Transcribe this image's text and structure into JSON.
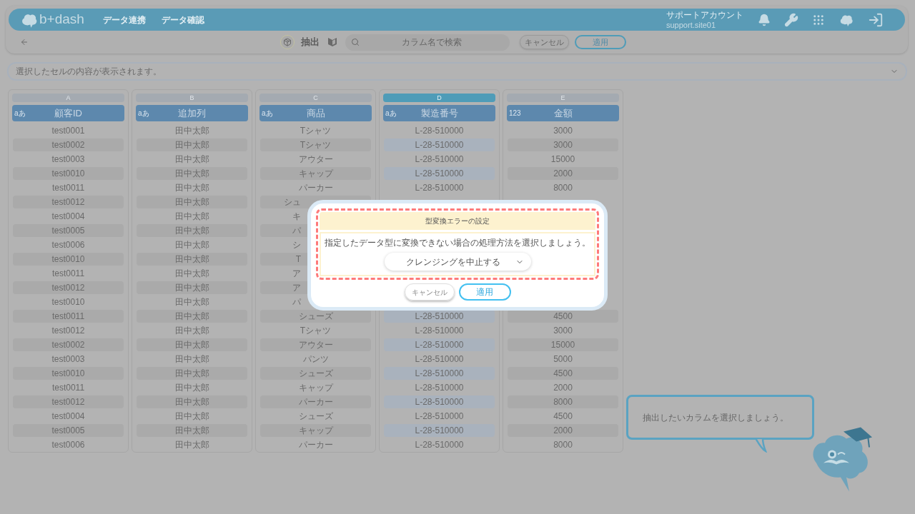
{
  "header": {
    "logo": "b+dash",
    "nav": [
      "データ連携",
      "データ確認"
    ],
    "account_name": "サポートアカウント",
    "account_id": "support.site01"
  },
  "toolbar": {
    "mode": "抽出",
    "search": {
      "placeholder": "カラム名で検索"
    },
    "cancel": "キャンセル",
    "apply": "適用"
  },
  "cell_view": {
    "placeholder": "選択したセルの内容が表示されます。"
  },
  "columns": [
    {
      "letter": "A",
      "selected": false,
      "type_icon": "aあ",
      "name": "顧客ID",
      "cells_above": [
        "test0001",
        "test0002",
        "test0003",
        "test0010",
        "test0011",
        "test0012",
        "test0004",
        "test0005",
        "test0006",
        "test0010",
        "test0011",
        "test0012",
        "test0010",
        "test0011",
        "test0012",
        "test0002",
        "test0003",
        "test0010",
        "test0011",
        "test0012",
        "test0004",
        "test0005",
        "test0006"
      ]
    },
    {
      "letter": "B",
      "selected": false,
      "type_icon": "aあ",
      "name": "追加列",
      "cells_above": [
        "田中太郎",
        "田中太郎",
        "田中太郎",
        "田中太郎",
        "田中太郎",
        "田中太郎",
        "田中太郎",
        "田中太郎",
        "田中太郎",
        "田中太郎",
        "田中太郎",
        "田中太郎",
        "田中太郎",
        "田中太郎",
        "田中太郎",
        "田中太郎",
        "田中太郎",
        "田中太郎",
        "田中太郎",
        "田中太郎",
        "田中太郎",
        "田中太郎",
        "田中太郎"
      ]
    },
    {
      "letter": "C",
      "selected": false,
      "type_icon": "aあ",
      "name": "商品",
      "cells_above": [
        "Tシャツ",
        "Tシャツ",
        "アウター",
        "キャップ",
        "パーカー"
      ],
      "cells_cut": [
        "シュ",
        "キ",
        "パ",
        "シ",
        "T",
        "ア",
        "ア",
        "パ"
      ],
      "cells_below": [
        "シューズ",
        "Tシャツ",
        "アウター",
        "パンツ",
        "シューズ",
        "キャップ",
        "パーカー",
        "シューズ",
        "キャップ",
        "パーカー"
      ]
    },
    {
      "letter": "D",
      "selected": true,
      "type_icon": "aあ",
      "name": "製造番号",
      "cells_above": [
        "L-28-510000",
        "L-28-510000",
        "L-28-510000",
        "L-28-510000",
        "L-28-510000"
      ],
      "cells_below": [
        "L-28-510000",
        "L-28-510000",
        "L-28-510000",
        "L-28-510000",
        "L-28-510000",
        "L-28-510000",
        "L-28-510000",
        "L-28-510000",
        "L-28-510000",
        "L-28-510000"
      ]
    },
    {
      "letter": "E",
      "selected": false,
      "type_icon": "123",
      "name": "金額",
      "cells_above": [
        "3000",
        "3000",
        "15000",
        "2000",
        "8000"
      ],
      "cells_below": [
        "4500",
        "3000",
        "15000",
        "5000",
        "4500",
        "2000",
        "8000",
        "4500",
        "2000",
        "8000"
      ]
    }
  ],
  "dialog": {
    "title": "型変換エラーの設定",
    "message": "指定したデータ型に変換できない場合の処理方法を選択しましょう。",
    "option": "クレンジングを中止する",
    "cancel": "キャンセル",
    "apply": "適用"
  },
  "hint": {
    "text": "抽出したいカラムを選択しましょう。"
  }
}
